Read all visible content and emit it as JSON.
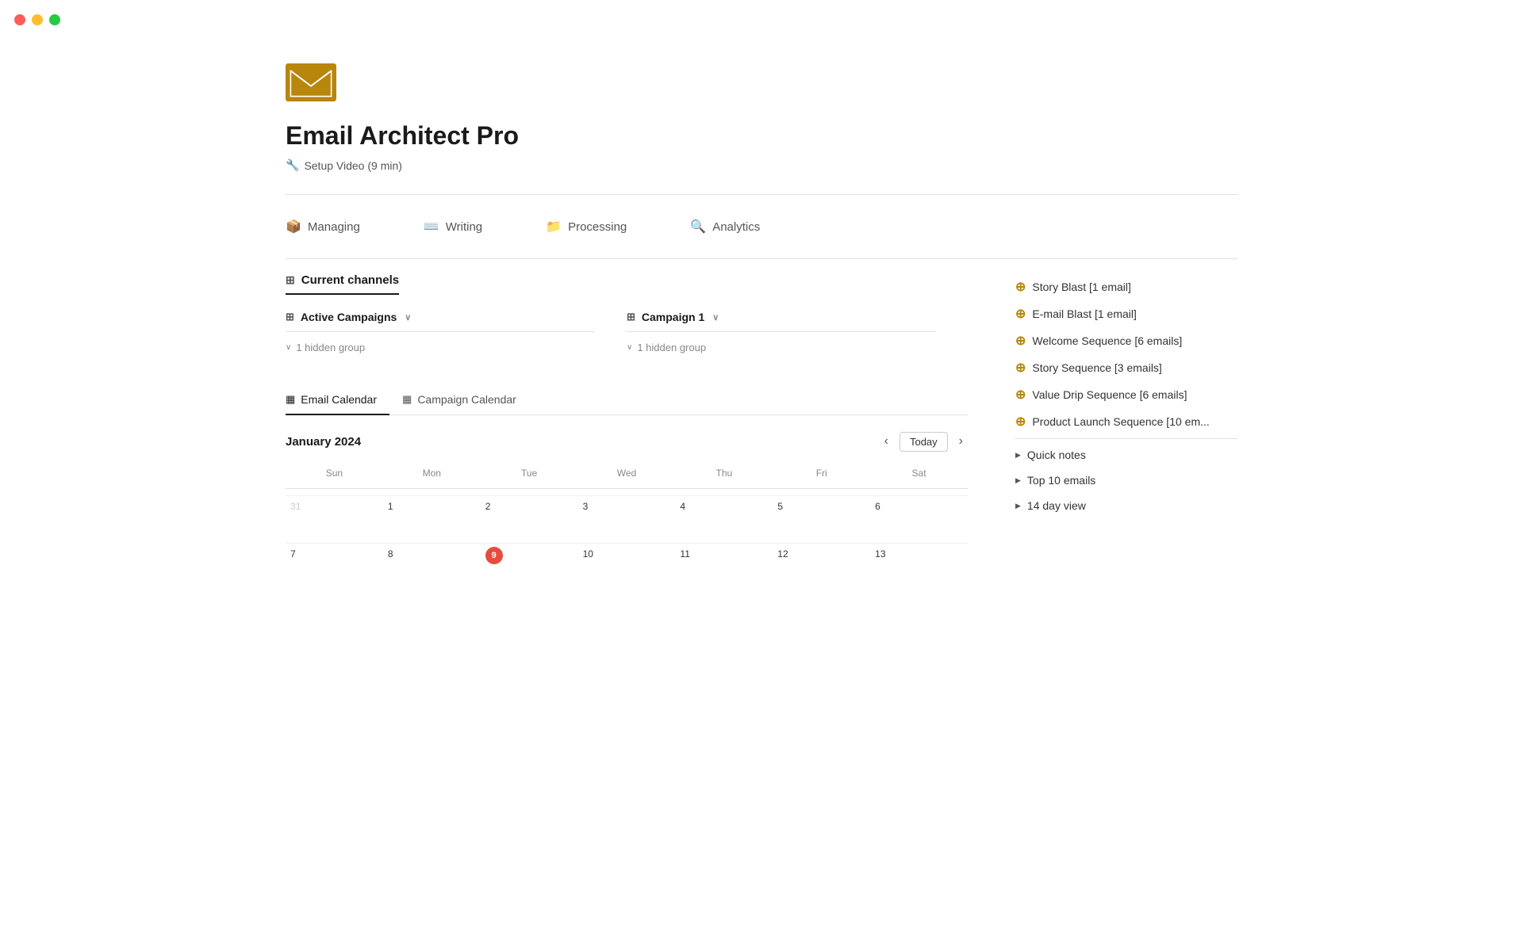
{
  "app": {
    "title": "Email Architect Pro",
    "setup_video": "Setup Video (9 min)"
  },
  "nav": {
    "tabs": [
      {
        "id": "managing",
        "label": "Managing",
        "icon": "📦",
        "class": "managing"
      },
      {
        "id": "writing",
        "label": "Writing",
        "icon": "⌨️",
        "class": "writing"
      },
      {
        "id": "processing",
        "label": "Processing",
        "icon": "📁",
        "class": "processing"
      },
      {
        "id": "analytics",
        "label": "Analytics",
        "icon": "🔍",
        "class": "analytics"
      }
    ]
  },
  "current_channels": {
    "label": "Current channels"
  },
  "campaigns": {
    "active": {
      "label": "Active Campaigns",
      "hidden_group": "1 hidden group"
    },
    "campaign1": {
      "label": "Campaign 1",
      "hidden_group": "1 hidden group"
    }
  },
  "sidebar": {
    "sequences": [
      {
        "label": "Story Blast [1 email]"
      },
      {
        "label": "E-mail Blast [1 email]"
      },
      {
        "label": "Welcome Sequence [6 emails]"
      },
      {
        "label": "Story Sequence [3 emails]"
      },
      {
        "label": "Value Drip Sequence [6 emails]"
      },
      {
        "label": "Product Launch Sequence [10 em..."
      }
    ],
    "expandables": [
      {
        "label": "Quick notes"
      },
      {
        "label": "Top 10 emails"
      },
      {
        "label": "14 day view"
      }
    ]
  },
  "calendar": {
    "tabs": [
      {
        "label": "Email Calendar",
        "active": true
      },
      {
        "label": "Campaign Calendar",
        "active": false
      }
    ],
    "month": "January 2024",
    "today_btn": "Today",
    "days": [
      "Sun",
      "Mon",
      "Tue",
      "Wed",
      "Thu",
      "Fri",
      "Sat"
    ],
    "today_date": "9"
  }
}
